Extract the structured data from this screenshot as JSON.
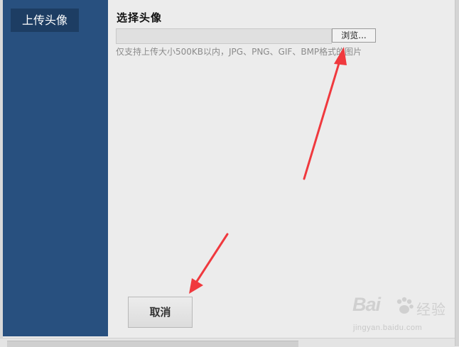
{
  "sidebar": {
    "tab_label": "上传头像"
  },
  "main": {
    "section_title": "选择头像",
    "file_input_value": "",
    "browse_label": "浏览...",
    "hint": "仅支持上传大小500KB以内，JPG、PNG、GIF、BMP格式的图片",
    "cancel_label": "取消"
  },
  "annotations": {
    "arrow_color": "#f0393e"
  },
  "watermark": {
    "logo": "Bai",
    "brand": "经验",
    "url": "jingyan.baidu.com"
  },
  "colors": {
    "sidebar": "#28507f",
    "sidebar_tab": "#1d3d63",
    "background": "#ececec"
  }
}
